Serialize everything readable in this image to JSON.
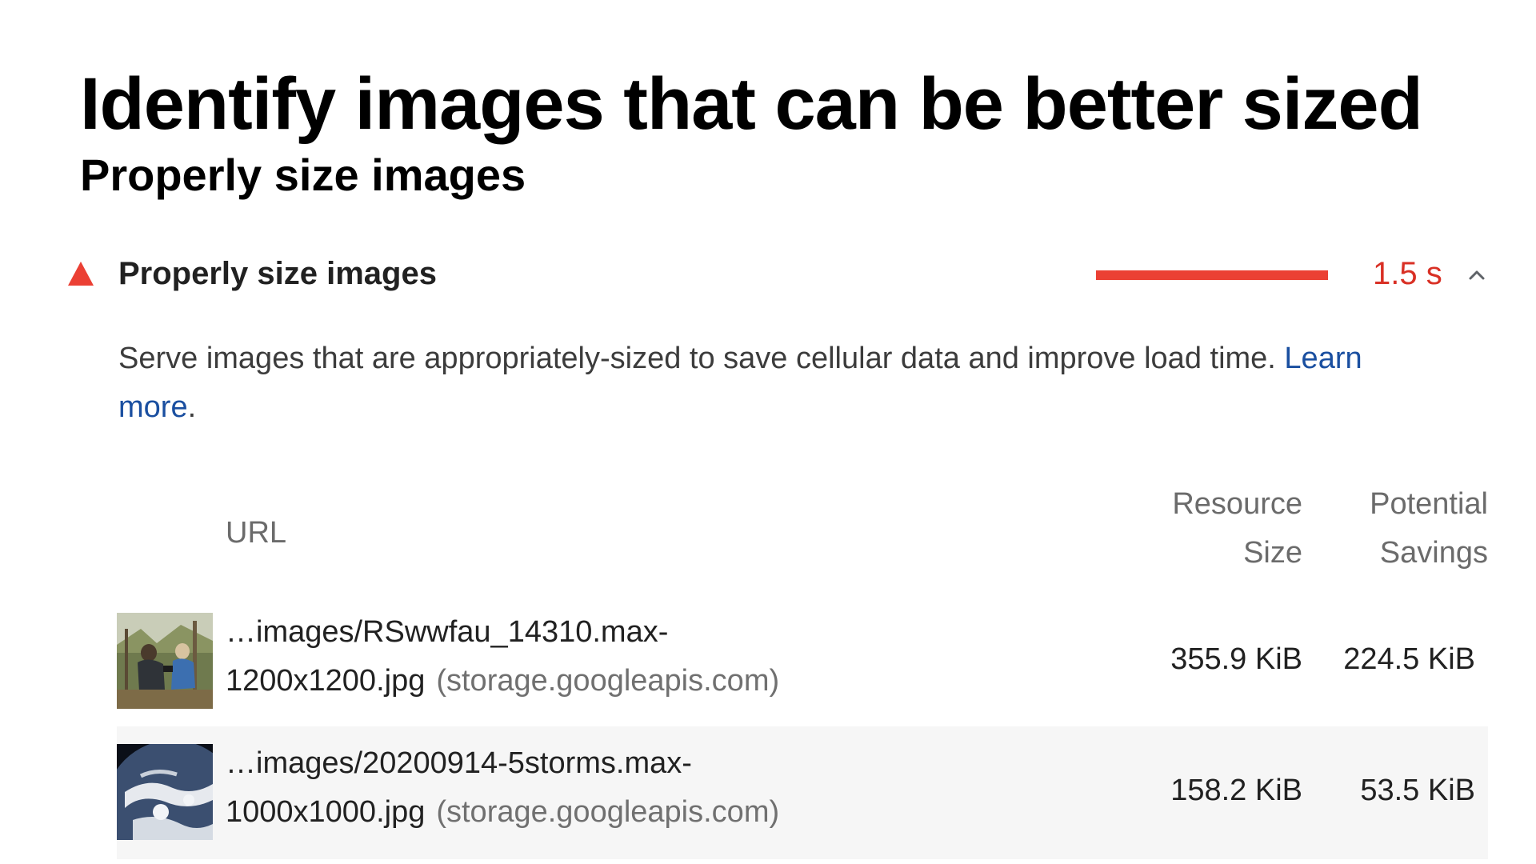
{
  "slide": {
    "title": "Identify images that can be better sized",
    "subtitle": "Properly size images"
  },
  "audit": {
    "title": "Properly size images",
    "status_icon": "warning-triangle-icon",
    "status_color": "#eb4034",
    "savings_display": "1.5 s",
    "savings_bar_fill_fraction": 1.0,
    "toggle_icon": "chevron-up-icon",
    "description": "Serve images that are appropriately-sized to save cellular data and improve load time.",
    "learn_more_link": "Learn more",
    "description_end": "."
  },
  "table": {
    "headers": {
      "url": "URL",
      "resource_size": "Resource Size",
      "potential_savings": "Potential Savings"
    },
    "rows": [
      {
        "thumbnail_icon": "photo-people-outdoors-thumbnail",
        "url": "…images/RSwwfau_14310.max-1200x1200.jpg",
        "host": "(storage.googleapis.com)",
        "resource_size": "355.9 KiB",
        "potential_savings": "224.5 KiB"
      },
      {
        "thumbnail_icon": "satellite-earth-thumbnail",
        "url": "…images/20200914-5storms.max-1000x1000.jpg",
        "host": "(storage.googleapis.com)",
        "resource_size": "158.2 KiB",
        "potential_savings": "53.5 KiB"
      }
    ]
  },
  "colors": {
    "link": "#1a4fa0",
    "warning": "#d93025",
    "row_alt_bg": "#f6f6f6"
  }
}
